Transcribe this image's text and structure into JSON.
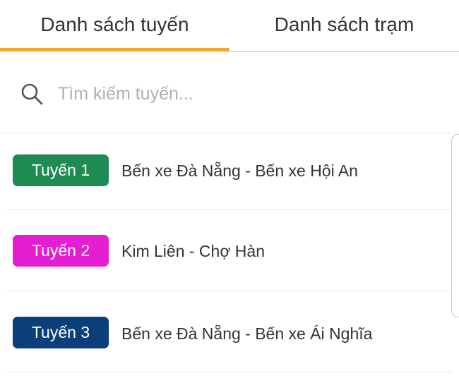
{
  "tabs": [
    {
      "label": "Danh sách tuyến",
      "active": true
    },
    {
      "label": "Danh sách trạm",
      "active": false
    }
  ],
  "colors": {
    "tab_indicator": "#f2a62a",
    "route_1": "#1e8c52",
    "route_2": "#e61ed2",
    "route_3": "#0b3f7a"
  },
  "search": {
    "placeholder": "Tìm kiếm tuyến...",
    "value": "",
    "icon": "search-icon"
  },
  "routes": [
    {
      "badge": "Tuyến 1",
      "name": "Bến xe Đà Nẵng - Bến xe Hội An",
      "color": "#1e8c52"
    },
    {
      "badge": "Tuyến 2",
      "name": "Kim Liên - Chợ Hàn",
      "color": "#e61ed2"
    },
    {
      "badge": "Tuyến 3",
      "name": "Bến xe Đà Nẵng - Bến xe Ái Nghĩa",
      "color": "#0b3f7a"
    }
  ]
}
